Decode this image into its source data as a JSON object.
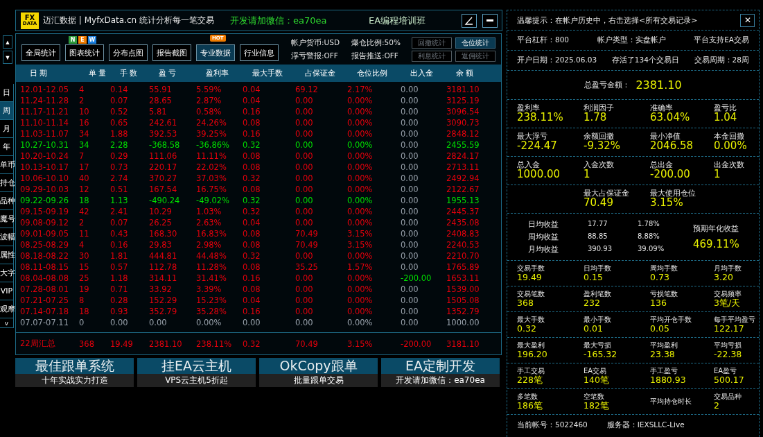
{
  "header": {
    "logo": {
      "top": "FX",
      "bottom": "DATA"
    },
    "title": "迈汇数据 | MyfxData.cn  统计分析每一笔交易",
    "contact": "开发请加微信：ea70ea",
    "course": "EA编程培训班"
  },
  "nav_arrows": [
    "▲",
    "▼"
  ],
  "side_tabs": [
    {
      "label": "日",
      "selected": false
    },
    {
      "label": "周",
      "selected": true
    },
    {
      "label": "月",
      "selected": false
    },
    {
      "label": "年",
      "selected": false
    },
    {
      "label": "单币",
      "selected": false
    },
    {
      "label": "持仓",
      "selected": false
    },
    {
      "label": "品种",
      "selected": false
    },
    {
      "label": "魔号",
      "selected": false
    },
    {
      "label": "波幅",
      "selected": false
    },
    {
      "label": "属性",
      "selected": false
    },
    {
      "label": "大字",
      "selected": false
    },
    {
      "label": "VIP",
      "selected": false
    },
    {
      "label": "观摩",
      "selected": false
    },
    {
      "label": "v",
      "selected": false
    }
  ],
  "toolbar": {
    "buttons": [
      {
        "label": "全局统计",
        "selected": false
      },
      {
        "label": "图表统计",
        "selected": false,
        "badge_letters": [
          "N",
          "E",
          "W"
        ]
      },
      {
        "label": "分布点图",
        "selected": false
      },
      {
        "label": "报告截图",
        "selected": false
      },
      {
        "label": "专业数据",
        "selected": true,
        "badge_text": "HOT"
      },
      {
        "label": "行业信息",
        "selected": false
      }
    ],
    "info": [
      "帐户货币:USD",
      "爆仓比例:50%",
      "浮亏警报:OFF",
      "报告推送:OFF"
    ],
    "stat_buttons": [
      {
        "label": "回撤统计",
        "selected": false
      },
      {
        "label": "仓位统计",
        "selected": true
      },
      {
        "label": "利息统计",
        "selected": false
      },
      {
        "label": "返佣统计",
        "selected": false
      }
    ]
  },
  "table": {
    "columns": [
      "日 期",
      "单 量",
      "手 数",
      "盈 亏",
      "盈利率",
      "最大手数",
      "占保证金",
      "仓位比例",
      "出入金",
      "余 额"
    ],
    "rows": [
      {
        "color": "#e8000c",
        "cells": [
          "12.01-12.05",
          "4",
          "0.14",
          "55.91",
          "5.59%",
          "0.04",
          "69.12",
          "2.17%"
        ],
        "cash": {
          "text": "0.00",
          "color": "#9aa3ad"
        },
        "balance": "3181.10"
      },
      {
        "color": "#e8000c",
        "cells": [
          "11.24-11.28",
          "2",
          "0.07",
          "28.65",
          "2.87%",
          "0.04",
          "0.00",
          "0.00%"
        ],
        "cash": {
          "text": "0.00",
          "color": "#9aa3ad"
        },
        "balance": "3125.19"
      },
      {
        "color": "#e8000c",
        "cells": [
          "11.17-11.21",
          "10",
          "0.52",
          "5.81",
          "0.58%",
          "0.16",
          "0.00",
          "0.00%"
        ],
        "cash": {
          "text": "0.00",
          "color": "#9aa3ad"
        },
        "balance": "3096.54"
      },
      {
        "color": "#e8000c",
        "cells": [
          "11.10-11.14",
          "16",
          "0.65",
          "242.61",
          "24.26%",
          "0.08",
          "0.00",
          "0.00%"
        ],
        "cash": {
          "text": "0.00",
          "color": "#9aa3ad"
        },
        "balance": "3090.73"
      },
      {
        "color": "#e8000c",
        "cells": [
          "11.03-11.07",
          "34",
          "1.88",
          "392.53",
          "39.25%",
          "0.16",
          "0.00",
          "0.00%"
        ],
        "cash": {
          "text": "0.00",
          "color": "#9aa3ad"
        },
        "balance": "2848.12"
      },
      {
        "color": "#00e000",
        "cells": [
          "10.27-10.31",
          "34",
          "2.28",
          "-368.58",
          "-36.86%",
          "0.32",
          "0.00",
          "0.00%"
        ],
        "cash": {
          "text": "0.00",
          "color": "#9aa3ad"
        },
        "balance": "2455.59"
      },
      {
        "color": "#e8000c",
        "cells": [
          "10.20-10.24",
          "7",
          "0.29",
          "111.06",
          "11.11%",
          "0.08",
          "0.00",
          "0.00%"
        ],
        "cash": {
          "text": "0.00",
          "color": "#9aa3ad"
        },
        "balance": "2824.17"
      },
      {
        "color": "#e8000c",
        "cells": [
          "10.13-10.17",
          "17",
          "0.73",
          "220.17",
          "22.02%",
          "0.08",
          "0.00",
          "0.00%"
        ],
        "cash": {
          "text": "0.00",
          "color": "#9aa3ad"
        },
        "balance": "2713.11"
      },
      {
        "color": "#e8000c",
        "cells": [
          "10.06-10.10",
          "40",
          "2.74",
          "370.27",
          "37.03%",
          "0.32",
          "0.00",
          "0.00%"
        ],
        "cash": {
          "text": "0.00",
          "color": "#9aa3ad"
        },
        "balance": "2492.94"
      },
      {
        "color": "#e8000c",
        "cells": [
          "09.29-10.03",
          "12",
          "0.51",
          "167.54",
          "16.75%",
          "0.08",
          "0.00",
          "0.00%"
        ],
        "cash": {
          "text": "0.00",
          "color": "#9aa3ad"
        },
        "balance": "2122.67"
      },
      {
        "color": "#00e000",
        "cells": [
          "09.22-09.26",
          "18",
          "1.13",
          "-490.24",
          "-49.02%",
          "0.32",
          "0.00",
          "0.00%"
        ],
        "cash": {
          "text": "0.00",
          "color": "#9aa3ad"
        },
        "balance": "1955.13"
      },
      {
        "color": "#e8000c",
        "cells": [
          "09.15-09.19",
          "42",
          "2.41",
          "10.29",
          "1.03%",
          "0.32",
          "0.00",
          "0.00%"
        ],
        "cash": {
          "text": "0.00",
          "color": "#9aa3ad"
        },
        "balance": "2445.37"
      },
      {
        "color": "#e8000c",
        "cells": [
          "09.08-09.12",
          "2",
          "0.07",
          "26.25",
          "2.63%",
          "0.04",
          "0.00",
          "0.00%"
        ],
        "cash": {
          "text": "0.00",
          "color": "#9aa3ad"
        },
        "balance": "2435.08"
      },
      {
        "color": "#e8000c",
        "cells": [
          "09.01-09.05",
          "11",
          "0.43",
          "168.30",
          "16.83%",
          "0.08",
          "70.49",
          "3.15%"
        ],
        "cash": {
          "text": "0.00",
          "color": "#9aa3ad"
        },
        "balance": "2408.83"
      },
      {
        "color": "#e8000c",
        "cells": [
          "08.25-08.29",
          "4",
          "0.16",
          "29.83",
          "2.98%",
          "0.08",
          "70.49",
          "3.15%"
        ],
        "cash": {
          "text": "0.00",
          "color": "#9aa3ad"
        },
        "balance": "2240.53"
      },
      {
        "color": "#e8000c",
        "cells": [
          "08.18-08.22",
          "30",
          "1.81",
          "444.81",
          "44.48%",
          "0.32",
          "0.00",
          "0.00%"
        ],
        "cash": {
          "text": "0.00",
          "color": "#9aa3ad"
        },
        "balance": "2210.70"
      },
      {
        "color": "#e8000c",
        "cells": [
          "08.11-08.15",
          "15",
          "0.57",
          "112.78",
          "11.28%",
          "0.08",
          "35.25",
          "1.57%"
        ],
        "cash": {
          "text": "0.00",
          "color": "#9aa3ad"
        },
        "balance": "1765.89"
      },
      {
        "color": "#e8000c",
        "cells": [
          "08.04-08.08",
          "25",
          "1.18",
          "314.11",
          "31.41%",
          "0.16",
          "0.00",
          "0.00%"
        ],
        "cash": {
          "text": "-200.00",
          "color": "#00e000"
        },
        "balance": "1653.11"
      },
      {
        "color": "#e8000c",
        "cells": [
          "07.28-08.01",
          "19",
          "0.71",
          "33.92",
          "3.39%",
          "0.08",
          "0.00",
          "0.00%"
        ],
        "cash": {
          "text": "0.00",
          "color": "#9aa3ad"
        },
        "balance": "1539.00"
      },
      {
        "color": "#e8000c",
        "cells": [
          "07.21-07.25",
          "8",
          "0.28",
          "152.29",
          "15.23%",
          "0.04",
          "0.00",
          "0.00%"
        ],
        "cash": {
          "text": "0.00",
          "color": "#9aa3ad"
        },
        "balance": "1505.08"
      },
      {
        "color": "#e8000c",
        "cells": [
          "07.14-07.18",
          "18",
          "0.93",
          "352.79",
          "35.28%",
          "0.16",
          "0.00",
          "0.00%"
        ],
        "cash": {
          "text": "0.00",
          "color": "#9aa3ad"
        },
        "balance": "1352.79"
      },
      {
        "color": "#9aa3ad",
        "cells": [
          "07.07-07.11",
          "0",
          "0.00",
          "0.00",
          "0.00%",
          "0.00",
          "0.00",
          "0.00%"
        ],
        "cash": {
          "text": "0.00",
          "color": "#9aa3ad"
        },
        "balance": "1000.00"
      }
    ],
    "summary": {
      "color": "#e8000c",
      "cells": [
        "22周汇总",
        "368",
        "19.49",
        "2381.10",
        "238.11%",
        "0.32",
        "70.49",
        "3.15%",
        "-200.00",
        "3181.10"
      ]
    }
  },
  "banners": [
    {
      "title": "最佳跟单系统",
      "subtitle": "十年实战实力打造"
    },
    {
      "title": "挂EA云主机",
      "subtitle": "VPS云主机5折起"
    },
    {
      "title": "OkCopy跟单",
      "subtitle": "批量跟单交易"
    },
    {
      "title": "EA定制开发",
      "subtitle": "开发请加微信：ea70ea"
    }
  ],
  "panel": {
    "notice": "温馨提示：在帐户历史中，右击选择<所有交易记录>",
    "close": "✕",
    "info_rows": [
      [
        "平台杠杆：800",
        "帐户类型：实盘帐户",
        "平台支持EA交易"
      ],
      [
        "开户日期：2025.06.03",
        "存活了134个交易日",
        "交易周期：28周"
      ]
    ],
    "total": {
      "label": "总盈亏金额：",
      "value": "2381.10"
    },
    "sections": [
      {
        "kind": "grid",
        "items": [
          {
            "label": "盈利率",
            "value": "238.11%"
          },
          {
            "label": "利润因子",
            "value": "1.78"
          },
          {
            "label": "准确率",
            "value": "63.04%"
          },
          {
            "label": "盈亏比",
            "value": "1.04"
          }
        ]
      },
      {
        "kind": "grid",
        "items": [
          {
            "label": "最大浮亏",
            "value": "-224.47"
          },
          {
            "label": "余额回撤",
            "value": "-9.32%"
          },
          {
            "label": "最小净值",
            "value": "2046.58"
          },
          {
            "label": "本金回撤",
            "value": "0.00%"
          }
        ]
      },
      {
        "kind": "grid",
        "items": [
          {
            "label": "总入金",
            "value": "1000.00"
          },
          {
            "label": "入金次数",
            "value": "1"
          },
          {
            "label": "总出金",
            "value": "-200.00"
          },
          {
            "label": "出金次数",
            "value": "1"
          }
        ]
      },
      {
        "kind": "pair",
        "items": [
          {
            "label": "最大占保证金",
            "value": "70.49"
          },
          {
            "label": "最大使用仓位",
            "value": "3.15%"
          }
        ]
      },
      {
        "kind": "averages",
        "rows": [
          {
            "label": "日均收益",
            "amount": "17.77",
            "pct": "1.78%"
          },
          {
            "label": "周均收益",
            "amount": "88.85",
            "pct": "8.88%"
          },
          {
            "label": "月均收益",
            "amount": "390.93",
            "pct": "39.09%"
          }
        ],
        "forecast": {
          "label": "预期年化收益",
          "value": "469.11%"
        }
      },
      {
        "kind": "small",
        "items": [
          {
            "label": "交易手数",
            "value": "19.49"
          },
          {
            "label": "日均手数",
            "value": "0.15"
          },
          {
            "label": "周均手数",
            "value": "0.73"
          },
          {
            "label": "月均手数",
            "value": "3.20"
          }
        ]
      },
      {
        "kind": "small",
        "items": [
          {
            "label": "交易笔数",
            "value": "368"
          },
          {
            "label": "盈利笔数",
            "value": "232"
          },
          {
            "label": "亏损笔数",
            "value": "136"
          },
          {
            "label": "交易频率",
            "value": "3笔/天"
          }
        ]
      },
      {
        "kind": "small",
        "items": [
          {
            "label": "最大手数",
            "value": "0.32"
          },
          {
            "label": "最小手数",
            "value": "0.01"
          },
          {
            "label": "平均开仓手数",
            "value": "0.05"
          },
          {
            "label": "每手平均盈亏",
            "value": "122.17"
          }
        ]
      },
      {
        "kind": "small",
        "items": [
          {
            "label": "最大盈利",
            "value": "196.20"
          },
          {
            "label": "最大亏损",
            "value": "-165.32"
          },
          {
            "label": "平均盈利",
            "value": "23.38"
          },
          {
            "label": "平均亏损",
            "value": "-22.38"
          }
        ]
      },
      {
        "kind": "small",
        "items": [
          {
            "label": "手工交易",
            "value": "228笔"
          },
          {
            "label": "EA交易",
            "value": "140笔"
          },
          {
            "label": "手工盈亏",
            "value": "1880.93"
          },
          {
            "label": "EA盈亏",
            "value": "500.17"
          }
        ]
      },
      {
        "kind": "small",
        "items": [
          {
            "label": "多笔数",
            "value": "186笔"
          },
          {
            "label": "空笔数",
            "value": "182笔"
          },
          {
            "label": "平均持仓时长"
          },
          {
            "label": "交易品种",
            "value": "2"
          }
        ]
      }
    ],
    "footer": [
      "当前帐号：5022460",
      "服务器：IEXSLLC-Live"
    ]
  }
}
